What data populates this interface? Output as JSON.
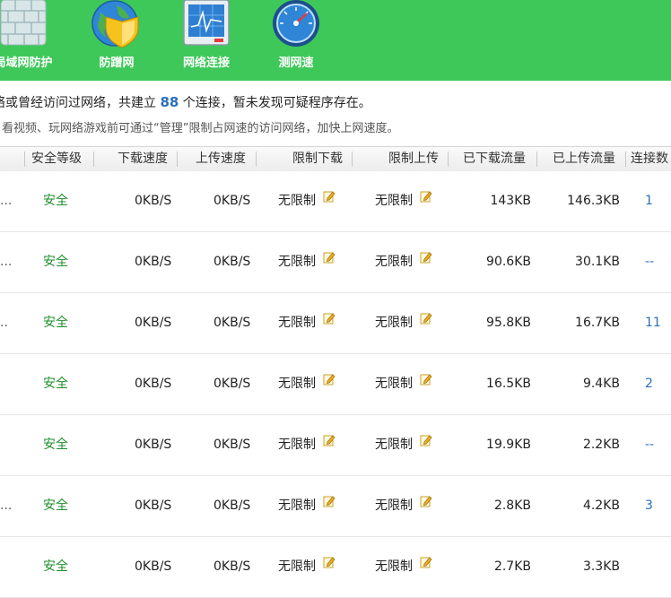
{
  "toolbar": {
    "items": [
      {
        "label": "局域网防护",
        "icon": "brick-wall-icon"
      },
      {
        "label": "防蹭网",
        "icon": "globe-shield-icon"
      },
      {
        "label": "网络连接",
        "icon": "network-monitor-icon"
      },
      {
        "label": "测网速",
        "icon": "speedometer-icon"
      }
    ]
  },
  "info": {
    "line1_pre": "络或曾经访问过网络，共建立 ",
    "line1_count": "88",
    "line1_post": " 个连接，暂未发现可疑程序存在。",
    "line2": "看视频、玩网络游戏前可通过“管理”限制占网速的访问网络，加快上网速度。"
  },
  "table": {
    "headers": [
      "安全等级",
      "下载速度",
      "上传速度",
      "限制下载",
      "限制上传",
      "已下载流量",
      "已上传流量",
      "连接数"
    ],
    "rows": [
      {
        "pre": "...",
        "level": "安全",
        "down": "0KB/S",
        "up": "0KB/S",
        "limit_down": "无限制",
        "limit_up": "无限制",
        "downloaded": "143KB",
        "uploaded": "146.3KB",
        "conn": "1"
      },
      {
        "pre": "...",
        "level": "安全",
        "down": "0KB/S",
        "up": "0KB/S",
        "limit_down": "无限制",
        "limit_up": "无限制",
        "downloaded": "90.6KB",
        "uploaded": "30.1KB",
        "conn": "--"
      },
      {
        "pre": "..",
        "level": "安全",
        "down": "0KB/S",
        "up": "0KB/S",
        "limit_down": "无限制",
        "limit_up": "无限制",
        "downloaded": "95.8KB",
        "uploaded": "16.7KB",
        "conn": "11"
      },
      {
        "pre": "",
        "level": "安全",
        "down": "0KB/S",
        "up": "0KB/S",
        "limit_down": "无限制",
        "limit_up": "无限制",
        "downloaded": "16.5KB",
        "uploaded": "9.4KB",
        "conn": "2"
      },
      {
        "pre": "",
        "level": "安全",
        "down": "0KB/S",
        "up": "0KB/S",
        "limit_down": "无限制",
        "limit_up": "无限制",
        "downloaded": "19.9KB",
        "uploaded": "2.2KB",
        "conn": "--"
      },
      {
        "pre": "...",
        "level": "安全",
        "down": "0KB/S",
        "up": "0KB/S",
        "limit_down": "无限制",
        "limit_up": "无限制",
        "downloaded": "2.8KB",
        "uploaded": "4.2KB",
        "conn": "3"
      },
      {
        "pre": "",
        "level": "安全",
        "down": "0KB/S",
        "up": "0KB/S",
        "limit_down": "无限制",
        "limit_up": "无限制",
        "downloaded": "2.7KB",
        "uploaded": "3.3KB",
        "conn": ""
      }
    ]
  },
  "colors": {
    "toolbar_bg": "#3ec85a",
    "safe": "#1e8f2c",
    "link": "#2b6fba"
  }
}
